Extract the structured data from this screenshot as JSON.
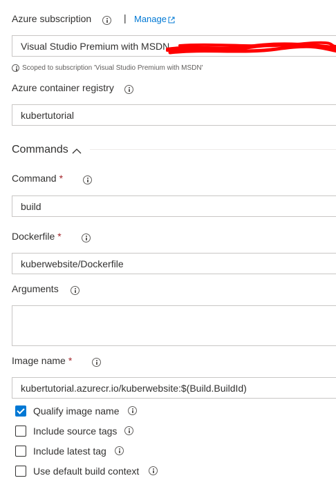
{
  "subscription": {
    "label": "Azure subscription",
    "manage_label": "Manage",
    "value": "Visual Studio Premium with MSDN",
    "scope_note": "Scoped to subscription 'Visual Studio Premium with MSDN'"
  },
  "registry": {
    "label": "Azure container registry",
    "value": "kubertutorial"
  },
  "commands_section": {
    "title": "Commands"
  },
  "command": {
    "label": "Command",
    "required_mark": "*",
    "value": "build"
  },
  "dockerfile": {
    "label": "Dockerfile",
    "required_mark": "*",
    "value": "kuberwebsite/Dockerfile"
  },
  "arguments": {
    "label": "Arguments",
    "value": ""
  },
  "image_name": {
    "label": "Image name",
    "required_mark": "*",
    "value": "kubertutorial.azurecr.io/kuberwebsite:$(Build.BuildId)"
  },
  "options": [
    {
      "label": "Qualify image name",
      "checked": true
    },
    {
      "label": "Include source tags",
      "checked": false
    },
    {
      "label": "Include latest tag",
      "checked": false
    },
    {
      "label": "Use default build context",
      "checked": false
    }
  ],
  "colors": {
    "accent": "#0078d4",
    "required": "#a4262c",
    "redaction": "#ff0000"
  }
}
